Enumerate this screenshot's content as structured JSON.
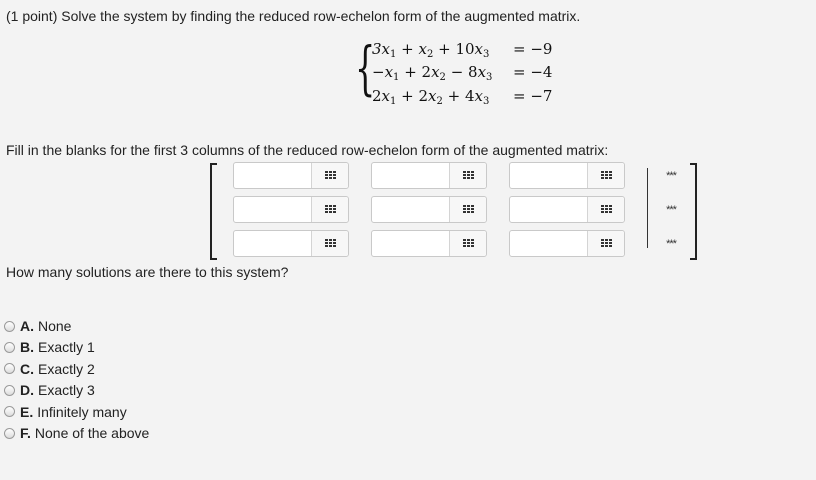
{
  "problem": {
    "prompt": "(1 point) Solve the system by finding the reduced row-echelon form of the augmented matrix.",
    "equations": [
      {
        "lhs": [
          "3",
          "x",
          "1",
          " + ",
          "",
          "x",
          "2",
          " + 10",
          "x",
          "3"
        ],
        "rhs": "= −9"
      },
      {
        "lhs": [
          "−",
          "x",
          "1",
          " + 2",
          "",
          "x",
          "2",
          " − 8",
          "x",
          "3"
        ],
        "rhs": "= −4"
      },
      {
        "lhs": [
          "2",
          "x",
          "1",
          " + 2",
          "",
          "x",
          "2",
          " + 4",
          "x",
          "3"
        ],
        "rhs": "= −7"
      }
    ],
    "fill_prompt": "Fill in the blanks for the first 3 columns of the reduced row-echelon form of the augmented matrix:",
    "matrix": {
      "rows": 3,
      "cols": 3,
      "cell_values": [
        [
          "",
          "",
          ""
        ],
        [
          "",
          "",
          ""
        ],
        [
          "",
          "",
          ""
        ]
      ],
      "augmented_placeholder": "***",
      "palette_icon": "grid-icon"
    },
    "question": "How many solutions are there to this system?",
    "choices": [
      {
        "letter": "A.",
        "text": "None"
      },
      {
        "letter": "B.",
        "text": "Exactly 1"
      },
      {
        "letter": "C.",
        "text": "Exactly 2"
      },
      {
        "letter": "D.",
        "text": "Exactly 3"
      },
      {
        "letter": "E.",
        "text": "Infinitely many"
      },
      {
        "letter": "F.",
        "text": "None of the above"
      }
    ]
  }
}
